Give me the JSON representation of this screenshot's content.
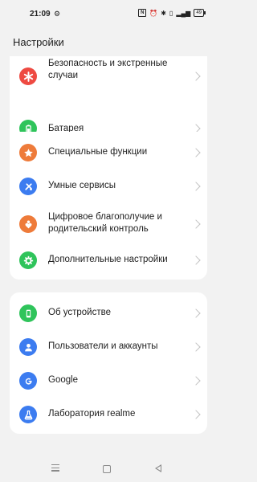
{
  "status_bar": {
    "time": "21:09",
    "battery": "49"
  },
  "header": {
    "title": "Настройки"
  },
  "card1": {
    "items": [
      {
        "label": "Безопасность и экстренные случаи",
        "icon": "emergency-asterisk-icon",
        "color": "#ee4a42"
      },
      {
        "label": "Батарея",
        "icon": "battery-icon",
        "color": "#2fc45b"
      }
    ]
  },
  "card2": {
    "items": [
      {
        "label": "Специальные функции",
        "icon": "star-icon",
        "color": "#ee7b3a"
      },
      {
        "label": "Умные сервисы",
        "icon": "smart-services-icon",
        "color": "#3c7cf0"
      },
      {
        "label": "Цифровое благополучие и родительский контроль",
        "icon": "heart-person-icon",
        "color": "#ee7b3a"
      },
      {
        "label": "Дополнительные настройки",
        "icon": "gear-icon",
        "color": "#2fc45b"
      }
    ]
  },
  "card3": {
    "items": [
      {
        "label": "Об устройстве",
        "icon": "phone-icon",
        "color": "#2fc45b"
      },
      {
        "label": "Пользователи и аккаунты",
        "icon": "user-icon",
        "color": "#3c7cf0"
      },
      {
        "label": "Google",
        "icon": "google-icon",
        "color": "#3c7cf0"
      },
      {
        "label": "Лаборатория realme",
        "icon": "flask-icon",
        "color": "#3c7cf0"
      }
    ]
  }
}
